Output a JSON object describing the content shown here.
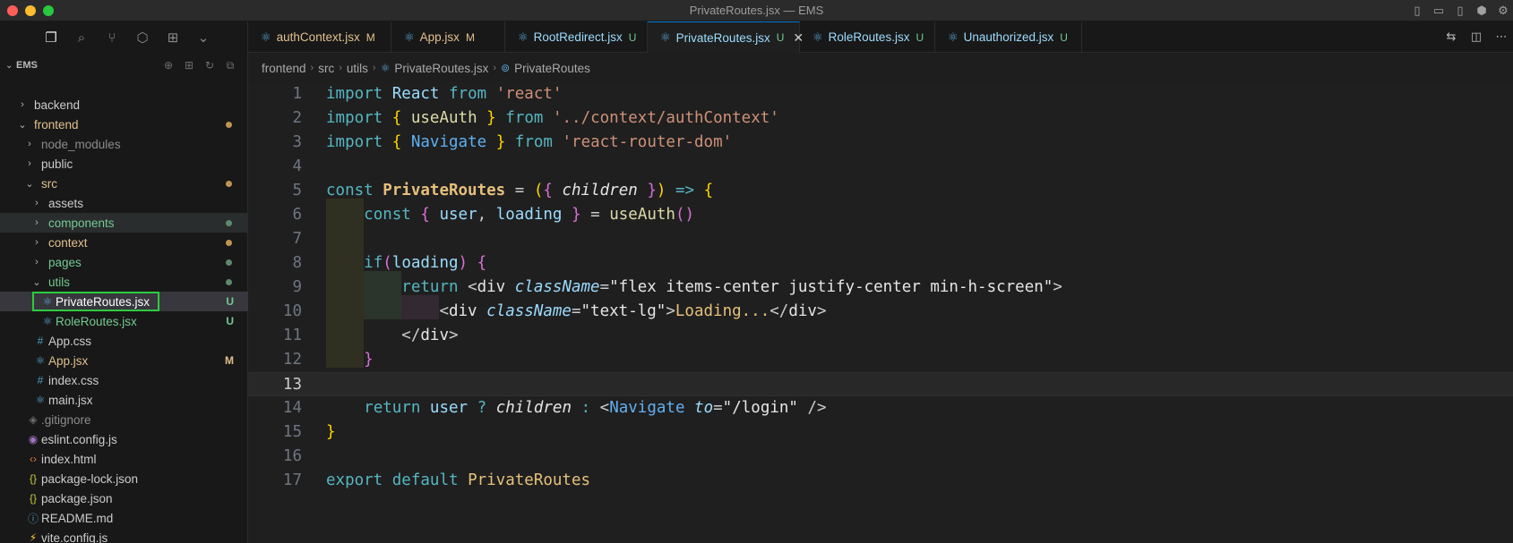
{
  "window": {
    "title": "PrivateRoutes.jsx — EMS"
  },
  "explorer": {
    "root_name": "EMS",
    "tree": [
      {
        "label": "backend",
        "type": "folder",
        "depth": 0,
        "expanded": false,
        "color": "#cccccc"
      },
      {
        "label": "frontend",
        "type": "folder",
        "depth": 0,
        "expanded": true,
        "color": "#e2c08d",
        "dot": "#c09553"
      },
      {
        "label": "node_modules",
        "type": "folder",
        "depth": 1,
        "expanded": false,
        "color": "#8c8c8c"
      },
      {
        "label": "public",
        "type": "folder",
        "depth": 1,
        "expanded": false,
        "color": "#cccccc"
      },
      {
        "label": "src",
        "type": "folder",
        "depth": 1,
        "expanded": true,
        "color": "#e2c08d",
        "dot": "#c09553"
      },
      {
        "label": "assets",
        "type": "folder",
        "depth": 2,
        "expanded": false,
        "color": "#cccccc"
      },
      {
        "label": "components",
        "type": "folder",
        "depth": 2,
        "expanded": false,
        "color": "#73c991",
        "dot": "#5b8a6b",
        "hover": true
      },
      {
        "label": "context",
        "type": "folder",
        "depth": 2,
        "expanded": false,
        "color": "#e2c08d",
        "dot": "#c09553"
      },
      {
        "label": "pages",
        "type": "folder",
        "depth": 2,
        "expanded": false,
        "color": "#73c991",
        "dot": "#5b8a6b"
      },
      {
        "label": "utils",
        "type": "folder",
        "depth": 2,
        "expanded": true,
        "color": "#73c991",
        "dot": "#5b8a6b"
      },
      {
        "label": "PrivateRoutes.jsx",
        "type": "react",
        "depth": 3,
        "color": "#ffffff",
        "badge": "U",
        "badge_color": "#73c991",
        "selected": true
      },
      {
        "label": "RoleRoutes.jsx",
        "type": "react",
        "depth": 3,
        "color": "#73c991",
        "badge": "U",
        "badge_color": "#73c991"
      },
      {
        "label": "App.css",
        "type": "css",
        "depth": 2,
        "color": "#cccccc"
      },
      {
        "label": "App.jsx",
        "type": "react",
        "depth": 2,
        "color": "#e2c08d",
        "badge": "M",
        "badge_color": "#e2c08d"
      },
      {
        "label": "index.css",
        "type": "css",
        "depth": 2,
        "color": "#cccccc"
      },
      {
        "label": "main.jsx",
        "type": "react",
        "depth": 2,
        "color": "#cccccc"
      },
      {
        "label": ".gitignore",
        "type": "git",
        "depth": 1,
        "color": "#8c8c8c"
      },
      {
        "label": "eslint.config.js",
        "type": "eslint",
        "depth": 1,
        "color": "#cccccc"
      },
      {
        "label": "index.html",
        "type": "html",
        "depth": 1,
        "color": "#cccccc"
      },
      {
        "label": "package-lock.json",
        "type": "json",
        "depth": 1,
        "color": "#cccccc"
      },
      {
        "label": "package.json",
        "type": "json",
        "depth": 1,
        "color": "#cccccc"
      },
      {
        "label": "README.md",
        "type": "info",
        "depth": 1,
        "color": "#cccccc"
      },
      {
        "label": "vite.config.js",
        "type": "vite",
        "depth": 1,
        "color": "#cccccc"
      }
    ]
  },
  "tabs": [
    {
      "name": "authContext.jsx",
      "status": "M",
      "kind": "m"
    },
    {
      "name": "App.jsx",
      "status": "M",
      "kind": "m"
    },
    {
      "name": "RootRedirect.jsx",
      "status": "U",
      "kind": "plain"
    },
    {
      "name": "PrivateRoutes.jsx",
      "status": "U",
      "kind": "plain",
      "active": true
    },
    {
      "name": "RoleRoutes.jsx",
      "status": "U",
      "kind": "plain"
    },
    {
      "name": "Unauthorized.jsx",
      "status": "U",
      "kind": "plain"
    }
  ],
  "breadcrumb": {
    "p1": "frontend",
    "p2": "src",
    "p3": "utils",
    "p4": "PrivateRoutes.jsx",
    "p5": "PrivateRoutes"
  },
  "editor": {
    "current_line": 13,
    "line_numbers": [
      "1",
      "2",
      "3",
      "4",
      "5",
      "6",
      "7",
      "8",
      "9",
      "10",
      "11",
      "12",
      "13",
      "14",
      "15",
      "16",
      "17"
    ],
    "code": {
      "import_kw": "import",
      "from_kw": "from",
      "react_id": "React",
      "react_str": "'react'",
      "useAuth_id": "useAuth",
      "auth_path": "'../context/authContext'",
      "navigate_id": "Navigate",
      "router_str": "'react-router-dom'",
      "const_kw": "const",
      "comp_name": "PrivateRoutes",
      "children": "children",
      "user": "user",
      "loading": "loading",
      "useAuth_call": "useAuth",
      "if_kw": "if",
      "return_kw": "return",
      "div": "div",
      "className": "className",
      "outer_class": "\"flex items-center justify-center min-h-screen\"",
      "inner_class": "\"text-lg\"",
      "loading_text": "Loading...",
      "to_attr": "to",
      "login_str": "\"/login\"",
      "export_kw": "export",
      "default_kw": "default"
    }
  }
}
